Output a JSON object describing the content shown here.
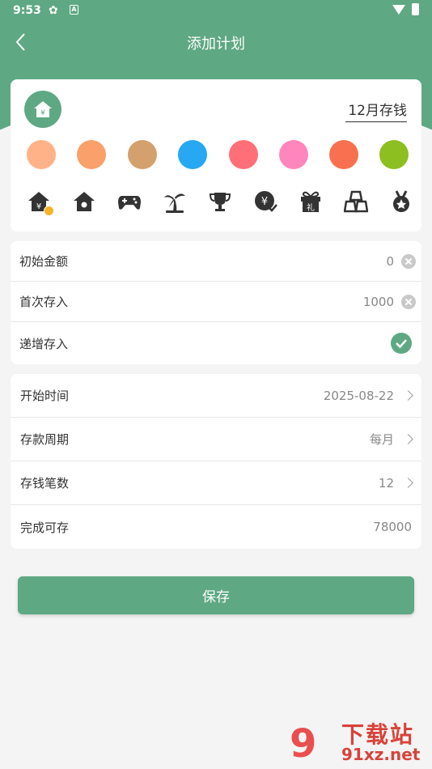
{
  "status": {
    "time": "9:53",
    "badge": "A"
  },
  "nav": {
    "title": "添加计划"
  },
  "plan": {
    "name": "12月存钱",
    "colors": [
      "#ffb287",
      "#f9a06b",
      "#d3a06e",
      "#27a8f2",
      "#ff6f77",
      "#ff86bd",
      "#f8704f",
      "#8cbf1f"
    ],
    "icons": [
      "piggy-house-yen-icon",
      "house-icon",
      "gamepad-icon",
      "palm-tree-icon",
      "trophy-icon",
      "yen-coin-icon",
      "gift-icon",
      "gold-bars-icon",
      "medal-icon"
    ]
  },
  "amounts": {
    "initial_label": "初始金额",
    "initial_value": "0",
    "first_label": "首次存入",
    "first_value": "1000",
    "increment_label": "递增存入"
  },
  "schedule": {
    "start_label": "开始时间",
    "start_value": "2025-08-22",
    "period_label": "存款周期",
    "period_value": "每月",
    "count_label": "存钱笔数",
    "count_value": "12",
    "total_label": "完成可存",
    "total_value": "78000"
  },
  "save_label": "保存",
  "watermark": {
    "title": "下载站",
    "domain": "91xz.net"
  }
}
